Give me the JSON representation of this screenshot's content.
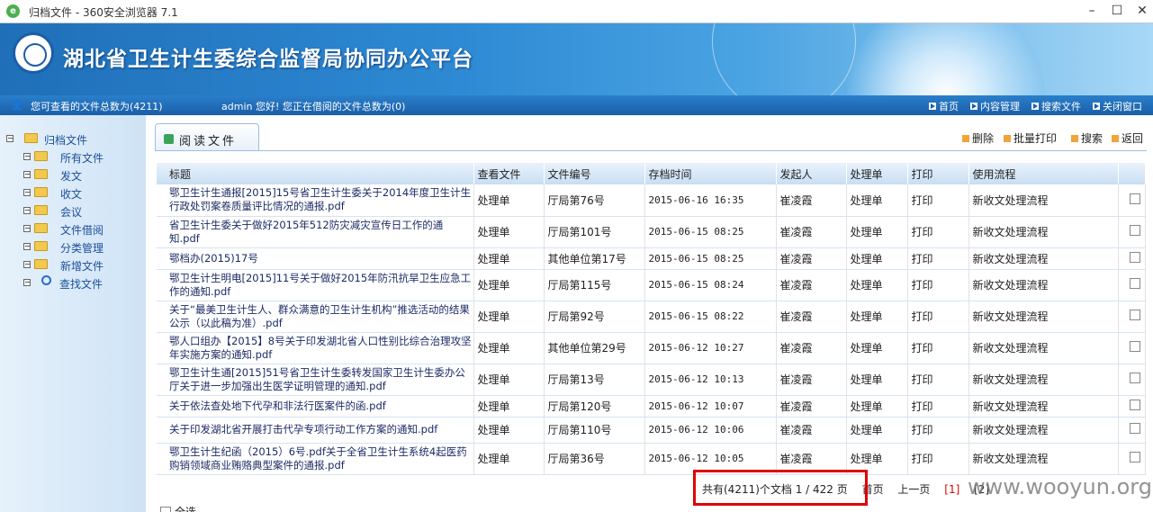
{
  "window": {
    "title": "归档文件 - 360安全浏览器 7.1",
    "icon": "browser-e-icon",
    "controls": [
      "minimize-icon",
      "maximize-icon",
      "close-icon"
    ]
  },
  "header": {
    "title": "湖北省卫生计生委综合监督局协同办公平台",
    "emblem": "national-emblem-icon"
  },
  "infobar": {
    "viewable_count": "您可查看的文件总数为(4211)",
    "greeting": "admin 您好! 您正在借阅的文件总数为(0)",
    "nav": [
      "首页",
      "内容管理",
      "搜索文件",
      "关闭窗口"
    ]
  },
  "sidebar": {
    "root": "归档文件",
    "items": [
      "所有文件",
      "发文",
      "收文",
      "会议",
      "文件借阅",
      "分类管理",
      "新增文件",
      "查找文件"
    ]
  },
  "tab": {
    "label": "阅读文件"
  },
  "actions": [
    "删除",
    "批量打印",
    "搜索",
    "返回"
  ],
  "table": {
    "headers": [
      "标题",
      "查看文件",
      "文件编号",
      "存档时间",
      "发起人",
      "处理单",
      "打印",
      "使用流程",
      ""
    ],
    "rows": [
      {
        "title": "鄂卫生计生通报[2015]15号省卫生计生委关于2014年度卫生计生行政处罚案卷质量评比情况的通报.pdf",
        "view": "处理单",
        "num": "厅局第76号",
        "time": "2015-06-16 16:35",
        "by": "崔凌霞",
        "proc": "处理单",
        "print": "打印",
        "flow": "新收文处理流程"
      },
      {
        "title": "省卫生计生委关于做好2015年512防灾减灾宣传日工作的通知.pdf",
        "view": "处理单",
        "num": "厅局第101号",
        "time": "2015-06-15 08:25",
        "by": "崔凌霞",
        "proc": "处理单",
        "print": "打印",
        "flow": "新收文处理流程"
      },
      {
        "title": "鄂档办(2015)17号",
        "view": "处理单",
        "num": "其他单位第17号",
        "time": "2015-06-15 08:25",
        "by": "崔凌霞",
        "proc": "处理单",
        "print": "打印",
        "flow": "新收文处理流程"
      },
      {
        "title": "鄂卫生计生明电[2015]11号关于做好2015年防汛抗旱卫生应急工作的通知.pdf",
        "view": "处理单",
        "num": "厅局第115号",
        "time": "2015-06-15 08:24",
        "by": "崔凌霞",
        "proc": "处理单",
        "print": "打印",
        "flow": "新收文处理流程"
      },
      {
        "title": "关于“最美卫生计生人、群众满意的卫生计生机构”推选活动的结果公示（以此稿为准）.pdf",
        "view": "处理单",
        "num": "厅局第92号",
        "time": "2015-06-15 08:22",
        "by": "崔凌霞",
        "proc": "处理单",
        "print": "打印",
        "flow": "新收文处理流程"
      },
      {
        "title": "鄂人口组办【2015】8号关于印发湖北省人口性别比综合治理攻坚年实施方案的通知.pdf",
        "view": "处理单",
        "num": "其他单位第29号",
        "time": "2015-06-12 10:27",
        "by": "崔凌霞",
        "proc": "处理单",
        "print": "打印",
        "flow": "新收文处理流程"
      },
      {
        "title": "鄂卫生计生通[2015]51号省卫生计生委转发国家卫生计生委办公厅关于进一步加强出生医学证明管理的通知.pdf",
        "view": "处理单",
        "num": "厅局第13号",
        "time": "2015-06-12 10:13",
        "by": "崔凌霞",
        "proc": "处理单",
        "print": "打印",
        "flow": "新收文处理流程"
      },
      {
        "title": "关于依法查处地下代孕和非法行医案件的函.pdf",
        "view": "处理单",
        "num": "厅局第120号",
        "time": "2015-06-12 10:07",
        "by": "崔凌霞",
        "proc": "处理单",
        "print": "打印",
        "flow": "新收文处理流程"
      },
      {
        "title": "关于印发湖北省开展打击代孕专项行动工作方案的通知.pdf",
        "view": "处理单",
        "num": "厅局第110号",
        "time": "2015-06-12 10:06",
        "by": "崔凌霞",
        "proc": "处理单",
        "print": "打印",
        "flow": "新收文处理流程"
      },
      {
        "title": "鄂卫生计生纪函（2015）6号.pdf关于全省卫生计生系统4起医药购销领域商业贿赂典型案件的通报.pdf",
        "view": "处理单",
        "num": "厅局第36号",
        "time": "2015-06-12 10:05",
        "by": "崔凌霞",
        "proc": "处理单",
        "print": "打印",
        "flow": "新收文处理流程"
      }
    ]
  },
  "pager": {
    "summary": "共有(4211)个文档 1 / 422 页",
    "first": "首页",
    "prev": "上一页",
    "pages": [
      "[1]",
      "[2]"
    ]
  },
  "select_all": "全选",
  "watermark": "www.wooyun.org",
  "colors": {
    "highlight": "#e00000",
    "banner": "#1f6fb8"
  }
}
